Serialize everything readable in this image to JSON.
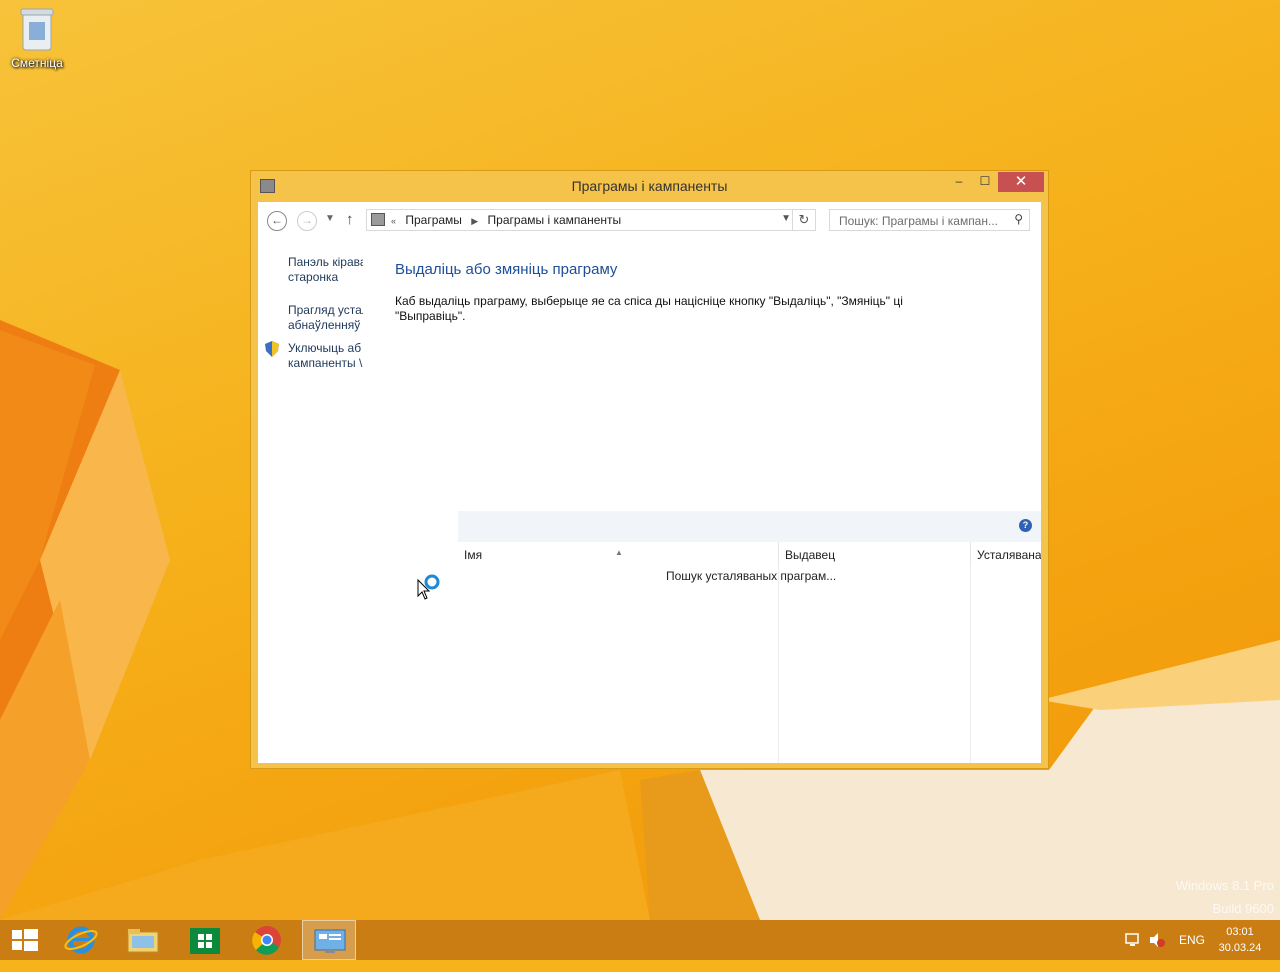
{
  "desktop": {
    "recycle_bin_label": "Сметніца",
    "watermark_line1": "Windows 8.1 Pro",
    "watermark_line2": "Build 9600"
  },
  "window": {
    "title": "Праграмы і кампаненты",
    "minimize": "‒",
    "maximize": "☐",
    "close": "✕",
    "breadcrumb_prefix": "«",
    "breadcrumb": [
      "Праграмы",
      "Праграмы і кампаненты"
    ],
    "search_placeholder": "Пошук: Праграмы і кампан..."
  },
  "left_nav": {
    "items": [
      {
        "label_line1": "Панэль кірава",
        "label_line2": "старонка"
      },
      {
        "label_line1": "Прагляд устал",
        "label_line2": "абнаўленняў"
      },
      {
        "label_line1": "Уключыць аб",
        "label_line2": "кампаненты \\"
      }
    ]
  },
  "main": {
    "heading": "Выдаліць або змяніць праграму",
    "description": "Каб выдаліць праграму, выберыце яе са спіса ды націсніце кнопку \"Выдаліць\", \"Змяніць\" ці \"Выправіць\".",
    "help_label": "?",
    "columns": [
      "Імя",
      "Выдавец",
      "Усталявана"
    ],
    "status": "Пошук усталяваных праграм..."
  },
  "taskbar": {
    "language": "ENG",
    "time": "03:01",
    "date": "30.03.24"
  },
  "colors": {
    "desktop_accent": "#f6b31a",
    "window_frame": "#f5c24a",
    "close_button": "#c75050",
    "heading_blue": "#1e4e9a",
    "taskbar": "#c97d12"
  }
}
